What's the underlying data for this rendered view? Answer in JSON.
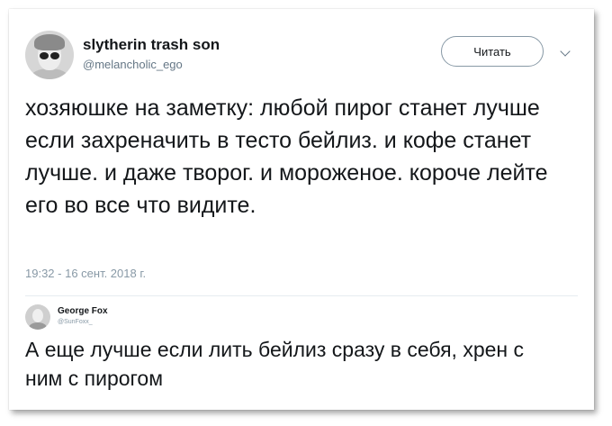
{
  "tweet": {
    "display_name": "slytherin trash son",
    "handle": "@melancholic_ego",
    "follow_label": "Читать",
    "text": "хозяюшке на заметку: любой пирог станет лучше если захреначить в тесто бейлиз. и кофе станет лучше. и даже творог. и мороженое. короче лейте его во все что видите.",
    "timestamp": "19:32 - 16 сент. 2018 г."
  },
  "reply": {
    "display_name": "George Fox",
    "handle": "@SunFoxx_",
    "text": "А еще лучше если лить бейлиз сразу в себя, хрен с ним с пирогом"
  },
  "icons": {
    "menu": "chevron-down-icon"
  }
}
